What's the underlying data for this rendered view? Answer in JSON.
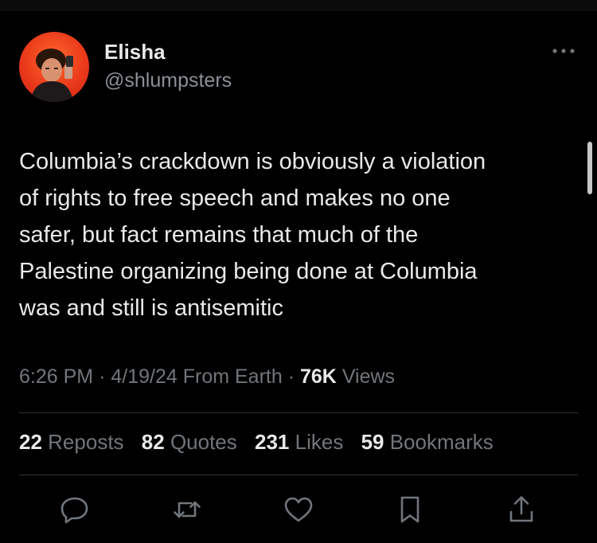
{
  "author": {
    "name": "Elisha",
    "handle": "@shlumpsters",
    "avatar_icon": "profile-photo"
  },
  "more_icon": "more-horizontal-icon",
  "tweet": {
    "text": "Columbia’s crackdown is obviously a violation\nof rights to free speech and makes no one\nsafer, but fact remains that much of the\nPalestine organizing being done at Columbia\nwas and still is antisemitic"
  },
  "meta": {
    "time": "6:26 PM",
    "date": "4/19/24",
    "source": "From Earth",
    "separator": "·",
    "views_count": "76K",
    "views_label": "Views"
  },
  "stats": [
    {
      "count": "22",
      "label": "Reposts"
    },
    {
      "count": "82",
      "label": "Quotes"
    },
    {
      "count": "231",
      "label": "Likes"
    },
    {
      "count": "59",
      "label": "Bookmarks"
    }
  ],
  "actions": [
    "reply-icon",
    "repost-icon",
    "like-icon",
    "bookmark-icon",
    "share-icon"
  ],
  "colors": {
    "background": "#000000",
    "text": "#e7e9ea",
    "secondary": "#71767b",
    "divider": "#2f3336",
    "avatar": "#e8361a"
  }
}
